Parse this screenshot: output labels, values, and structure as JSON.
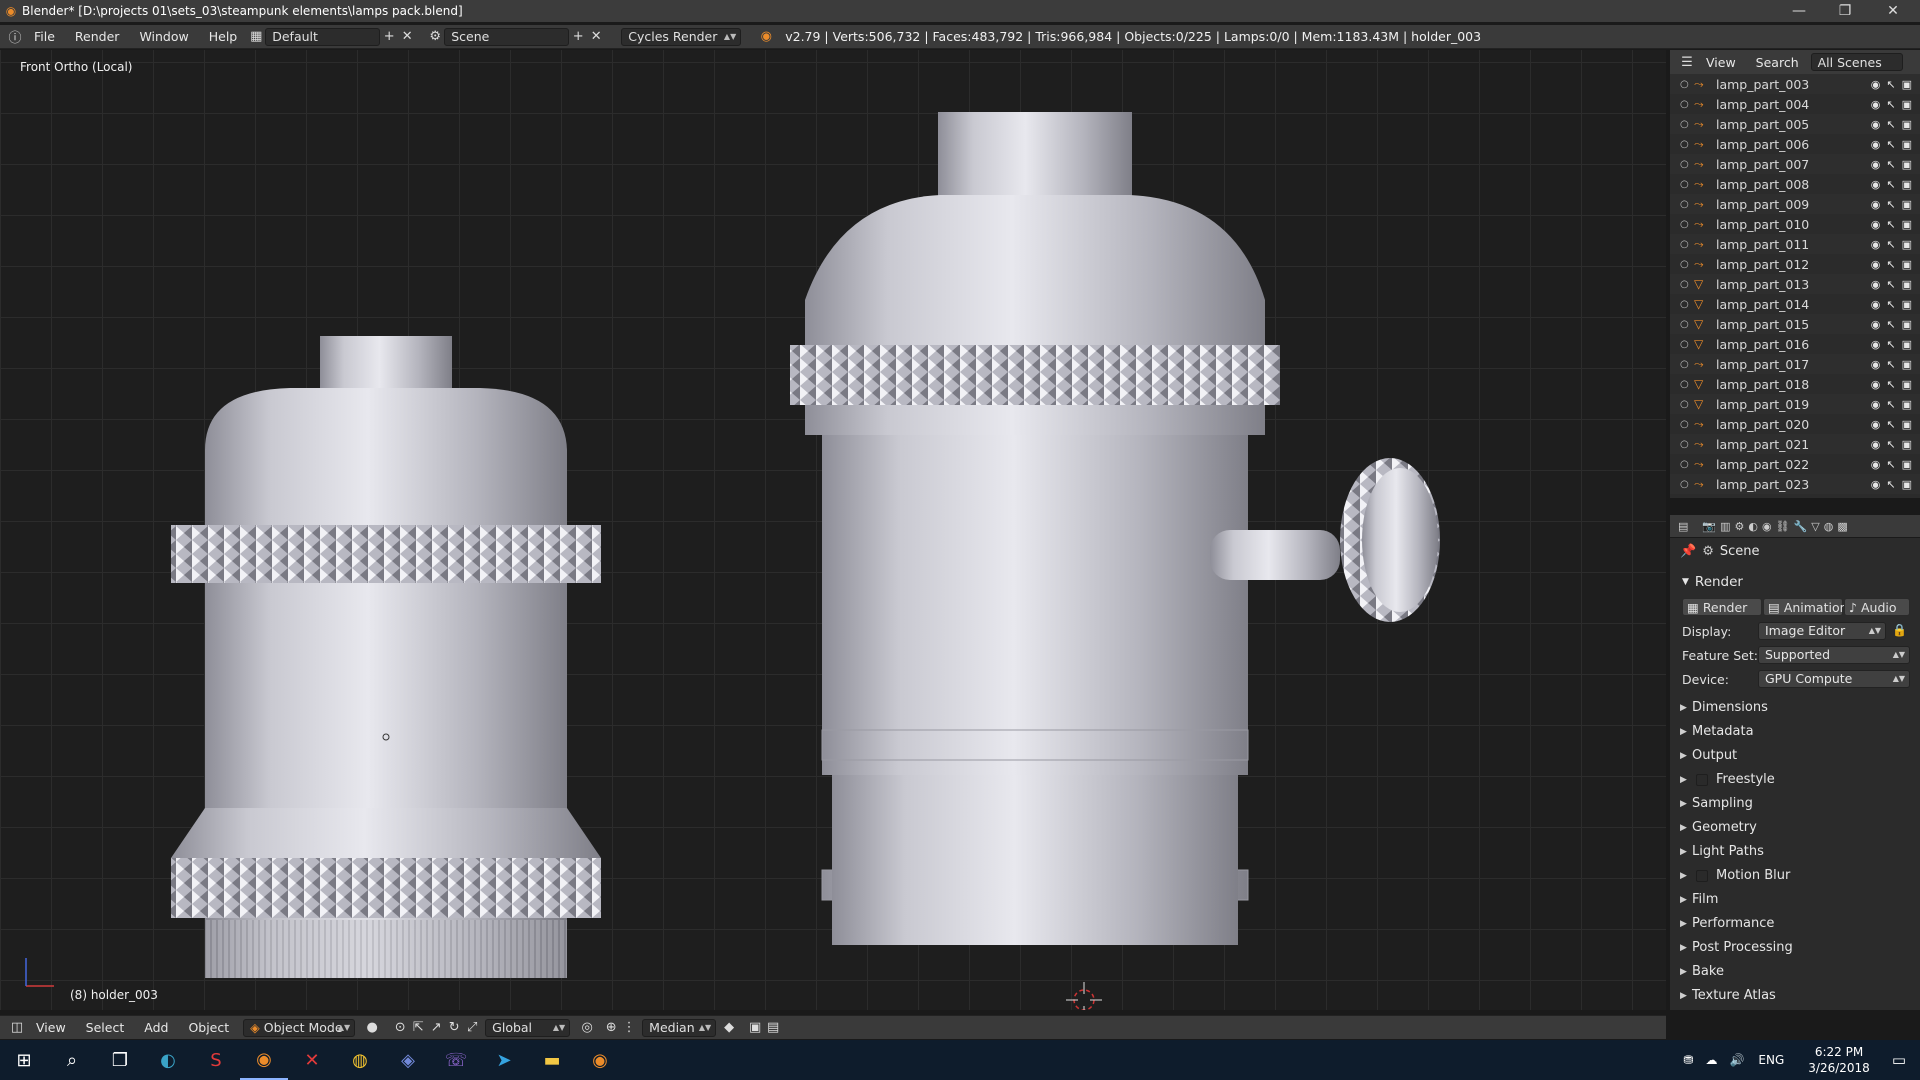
{
  "window": {
    "title": "Blender* [D:\\projects 01\\sets_03\\steampunk elements\\lamps pack.blend]",
    "min": "—",
    "max": "❐",
    "close": "✕"
  },
  "info": {
    "menus": [
      "File",
      "Render",
      "Window",
      "Help"
    ],
    "layout": "Default",
    "scene": "Scene",
    "engine": "Cycles Render",
    "stats": "v2.79 | Verts:506,732 | Faces:483,792 | Tris:966,984 | Objects:0/225 | Lamps:0/0 | Mem:1183.43M | holder_003"
  },
  "viewport": {
    "view_label": "Front Ortho (Local)",
    "object_label": "(8) holder_003"
  },
  "view3d_header": {
    "menus": [
      "View",
      "Select",
      "Add",
      "Object"
    ],
    "mode": "Object Mode",
    "orientation": "Global",
    "pivot": "Median"
  },
  "outliner": {
    "menus": [
      "View",
      "Search"
    ],
    "filter": "All Scenes",
    "items": [
      {
        "name": "lamp_part_003",
        "type": "curve"
      },
      {
        "name": "lamp_part_004",
        "type": "curve"
      },
      {
        "name": "lamp_part_005",
        "type": "curve"
      },
      {
        "name": "lamp_part_006",
        "type": "curve"
      },
      {
        "name": "lamp_part_007",
        "type": "curve"
      },
      {
        "name": "lamp_part_008",
        "type": "curve"
      },
      {
        "name": "lamp_part_009",
        "type": "curve"
      },
      {
        "name": "lamp_part_010",
        "type": "curve"
      },
      {
        "name": "lamp_part_011",
        "type": "curve"
      },
      {
        "name": "lamp_part_012",
        "type": "curve"
      },
      {
        "name": "lamp_part_013",
        "type": "mesh"
      },
      {
        "name": "lamp_part_014",
        "type": "mesh"
      },
      {
        "name": "lamp_part_015",
        "type": "mesh"
      },
      {
        "name": "lamp_part_016",
        "type": "mesh"
      },
      {
        "name": "lamp_part_017",
        "type": "curve"
      },
      {
        "name": "lamp_part_018",
        "type": "mesh"
      },
      {
        "name": "lamp_part_019",
        "type": "mesh"
      },
      {
        "name": "lamp_part_020",
        "type": "curve"
      },
      {
        "name": "lamp_part_021",
        "type": "curve"
      },
      {
        "name": "lamp_part_022",
        "type": "curve"
      },
      {
        "name": "lamp_part_023",
        "type": "curve"
      }
    ]
  },
  "properties": {
    "context": "Scene",
    "panel_title": "Render",
    "buttons": {
      "render": "Render",
      "animation": "Animation",
      "audio": "Audio"
    },
    "display_label": "Display:",
    "display_value": "Image Editor",
    "feature_label": "Feature Set:",
    "feature_value": "Supported",
    "device_label": "Device:",
    "device_value": "GPU Compute",
    "sections": [
      "Dimensions",
      "Metadata",
      "Output",
      "Freestyle",
      "Sampling",
      "Geometry",
      "Light Paths",
      "Motion Blur",
      "Film",
      "Performance",
      "Post Processing",
      "Bake",
      "Texture Atlas"
    ],
    "checkbox_sections": [
      "Freestyle",
      "Motion Blur"
    ]
  },
  "taskbar": {
    "time": "6:22 PM",
    "date": "3/26/2018",
    "lang": "ENG"
  },
  "colors": {
    "accent": "#ec8c2a",
    "panel": "#3a3a3a",
    "viewport_bg": "#1e1e1e",
    "taskbar": "#0e1c2c"
  }
}
